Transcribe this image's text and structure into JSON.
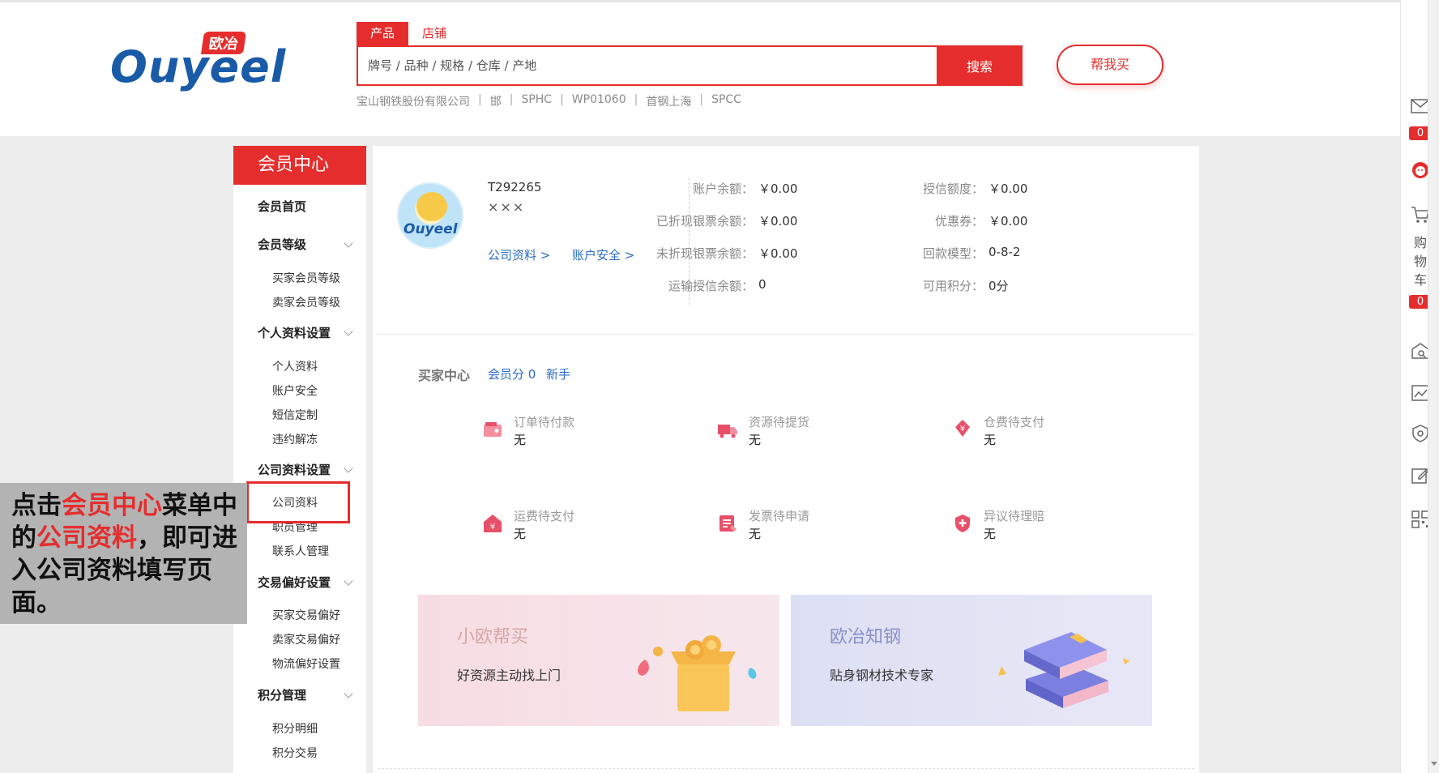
{
  "header": {
    "logo_badge": "欧冶",
    "logo_text": "Ouyeel",
    "search_tabs": [
      "产品",
      "店铺"
    ],
    "search_placeholder": "牌号 / 品种 / 规格 / 仓库 / 产地",
    "search_button": "搜索",
    "help_button": "帮我买",
    "hot_words": [
      "宝山钢铁股份有限公司",
      "邯",
      "SPHC",
      "WP01060",
      "首钢上海",
      "SPCC"
    ],
    "hot_separator": "|"
  },
  "sidebar": {
    "title": "会员中心",
    "home": "会员首页",
    "groups": [
      {
        "label": "会员等级",
        "items": [
          "买家会员等级",
          "卖家会员等级"
        ]
      },
      {
        "label": "个人资料设置",
        "items": [
          "个人资料",
          "账户安全",
          "短信定制",
          "违约解冻"
        ]
      },
      {
        "label": "公司资料设置",
        "items": [
          "公司资料",
          "职员管理",
          "联系人管理"
        ]
      },
      {
        "label": "交易偏好设置",
        "items": [
          "买家交易偏好",
          "卖家交易偏好",
          "物流偏好设置"
        ]
      },
      {
        "label": "积分管理",
        "items": [
          "积分明细",
          "积分交易"
        ]
      }
    ]
  },
  "callout": {
    "p1": "点击",
    "r1": "会员中心",
    "p2": "菜单中的",
    "r2": "公司资料",
    "p3": "，即可进入公司资料填写页面。"
  },
  "profile": {
    "avatar_text": "Ouyeel",
    "user_id": "T292265",
    "user_name": "×××",
    "link_company": "公司资料 >",
    "link_security": "账户安全 >"
  },
  "account": {
    "left": [
      {
        "label": "账户余额：",
        "value": "￥0.00"
      },
      {
        "label": "已折现银票余额：",
        "value": "￥0.00"
      },
      {
        "label": "未折现银票余额：",
        "value": "￥0.00"
      },
      {
        "label": "运输授信余额：",
        "value": "0"
      }
    ],
    "right": [
      {
        "label": "授信额度：",
        "value": "￥0.00"
      },
      {
        "label": "优惠券：",
        "value": "￥0.00"
      },
      {
        "label": "回款模型：",
        "value": "0-8-2"
      },
      {
        "label": "可用积分：",
        "value": "0分"
      }
    ]
  },
  "buyer_center": {
    "title": "买家中心",
    "score": "会员分 0",
    "newbie": "新手",
    "tasks": [
      {
        "label": "订单待付款",
        "value": "无",
        "icon": "wallet-icon"
      },
      {
        "label": "资源待提货",
        "value": "无",
        "icon": "truck-icon"
      },
      {
        "label": "仓费待支付",
        "value": "无",
        "icon": "money-tag-icon"
      },
      {
        "label": "运费待支付",
        "value": "无",
        "icon": "warehouse-icon"
      },
      {
        "label": "发票待申请",
        "value": "无",
        "icon": "invoice-icon"
      },
      {
        "label": "异议待理赔",
        "value": "无",
        "icon": "shield-hand-icon"
      }
    ]
  },
  "banners": [
    {
      "title": "小欧帮买",
      "subtitle": "好资源主动找上门"
    },
    {
      "title": "欧冶知钢",
      "subtitle": "贴身钢材技术专家"
    }
  ],
  "rail": {
    "message_count": "0",
    "cart_label": [
      "购",
      "物",
      "车"
    ],
    "cart_count": "0"
  },
  "colors": {
    "brand_red": "#e52d2d",
    "link_blue": "#2b6cc4",
    "logo_blue": "#1a5ba8"
  }
}
